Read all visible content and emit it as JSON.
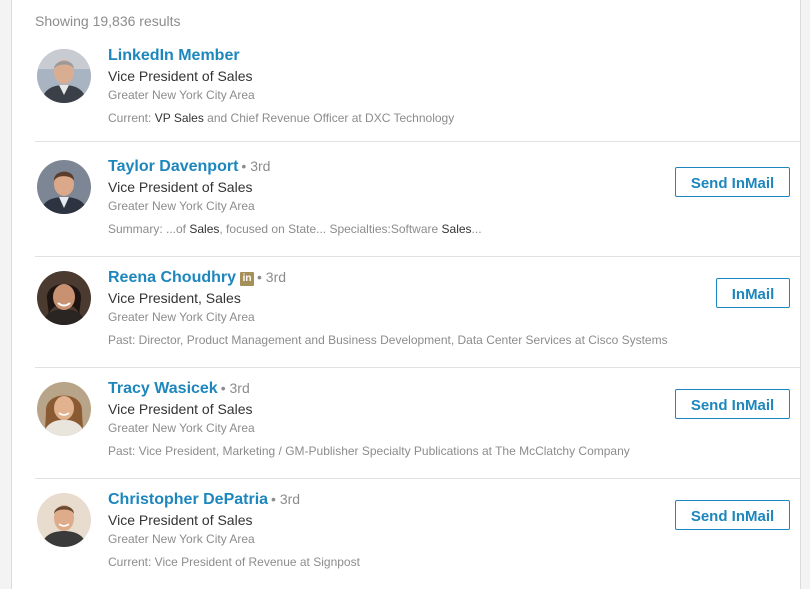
{
  "results": {
    "count_label": "Showing 19,836 results",
    "people": [
      {
        "name": "LinkedIn Member",
        "degree": "",
        "title": "Vice President of Sales",
        "location": "Greater New York City Area",
        "snippet": [
          {
            "text": "Current: ",
            "hl": false
          },
          {
            "text": "VP Sales",
            "hl": true
          },
          {
            "text": " and Chief Revenue Officer at DXC Technology",
            "hl": false
          }
        ],
        "button": ""
      },
      {
        "name": "Taylor Davenport",
        "degree": "• 3rd",
        "title": "Vice President of Sales",
        "location": "Greater New York City Area",
        "snippet": [
          {
            "text": "Summary: ...of ",
            "hl": false
          },
          {
            "text": "Sales",
            "hl": true
          },
          {
            "text": ", focused on State... Specialties:Software ",
            "hl": false
          },
          {
            "text": "Sales",
            "hl": true
          },
          {
            "text": "...",
            "hl": false
          }
        ],
        "button": "Send InMail"
      },
      {
        "name": "Reena Choudhry",
        "premium_badge": "in",
        "degree": "• 3rd",
        "title": "Vice President, Sales",
        "location": "Greater New York City Area",
        "snippet": [
          {
            "text": "Past: Director, Product Management and Business Development, Data Center Services at Cisco Systems",
            "hl": false
          }
        ],
        "button": "InMail"
      },
      {
        "name": "Tracy Wasicek",
        "degree": "• 3rd",
        "title": "Vice President of Sales",
        "location": "Greater New York City Area",
        "snippet": [
          {
            "text": "Past: Vice President, Marketing / GM-Publisher Specialty Publications at The McClatchy Company",
            "hl": false
          }
        ],
        "button": "Send InMail"
      },
      {
        "name": "Christopher DePatria",
        "degree": "• 3rd",
        "title": "Vice President of Sales",
        "location": "Greater New York City Area",
        "snippet": [
          {
            "text": "Current: Vice President of Revenue at Signpost",
            "hl": false
          }
        ],
        "button": "Send InMail"
      }
    ]
  },
  "colors": {
    "link": "#1d87bd",
    "muted": "#8c8c8c",
    "premium_badge": "#a5905a"
  }
}
